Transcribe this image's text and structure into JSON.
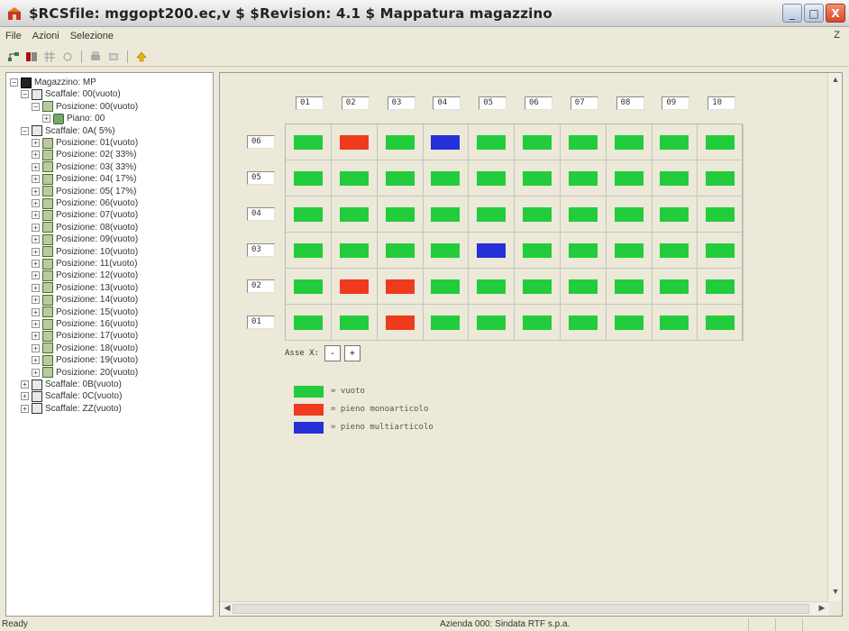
{
  "window": {
    "title": "$RCSfile: mggopt200.ec,v $ $Revision: 4.1 $ Mappatura magazzino",
    "min_glyph": "_",
    "max_glyph": "□",
    "close_glyph": "X"
  },
  "menu": {
    "items": [
      "File",
      "Azioni",
      "Selezione"
    ],
    "right_mark": "Z"
  },
  "tree": {
    "nodes": [
      {
        "level": 0,
        "exp": "−",
        "icon": "magazzino",
        "label": "Magazzino: MP"
      },
      {
        "level": 1,
        "exp": "−",
        "icon": "scaffale",
        "label": "Scaffale: 00(vuoto)"
      },
      {
        "level": 2,
        "exp": "−",
        "icon": "posizione",
        "label": "Posizione: 00(vuoto)"
      },
      {
        "level": 3,
        "exp": "+",
        "icon": "piano",
        "label": "Piano: 00"
      },
      {
        "level": 1,
        "exp": "−",
        "icon": "scaffale",
        "label": "Scaffale: 0A( 5%)"
      },
      {
        "level": 2,
        "exp": "+",
        "icon": "posizione",
        "label": "Posizione: 01(vuoto)"
      },
      {
        "level": 2,
        "exp": "+",
        "icon": "posizione",
        "label": "Posizione: 02( 33%)"
      },
      {
        "level": 2,
        "exp": "+",
        "icon": "posizione",
        "label": "Posizione: 03( 33%)"
      },
      {
        "level": 2,
        "exp": "+",
        "icon": "posizione",
        "label": "Posizione: 04( 17%)"
      },
      {
        "level": 2,
        "exp": "+",
        "icon": "posizione",
        "label": "Posizione: 05( 17%)"
      },
      {
        "level": 2,
        "exp": "+",
        "icon": "posizione",
        "label": "Posizione: 06(vuoto)"
      },
      {
        "level": 2,
        "exp": "+",
        "icon": "posizione",
        "label": "Posizione: 07(vuoto)"
      },
      {
        "level": 2,
        "exp": "+",
        "icon": "posizione",
        "label": "Posizione: 08(vuoto)"
      },
      {
        "level": 2,
        "exp": "+",
        "icon": "posizione",
        "label": "Posizione: 09(vuoto)"
      },
      {
        "level": 2,
        "exp": "+",
        "icon": "posizione",
        "label": "Posizione: 10(vuoto)"
      },
      {
        "level": 2,
        "exp": "+",
        "icon": "posizione",
        "label": "Posizione: 11(vuoto)"
      },
      {
        "level": 2,
        "exp": "+",
        "icon": "posizione",
        "label": "Posizione: 12(vuoto)"
      },
      {
        "level": 2,
        "exp": "+",
        "icon": "posizione",
        "label": "Posizione: 13(vuoto)"
      },
      {
        "level": 2,
        "exp": "+",
        "icon": "posizione",
        "label": "Posizione: 14(vuoto)"
      },
      {
        "level": 2,
        "exp": "+",
        "icon": "posizione",
        "label": "Posizione: 15(vuoto)"
      },
      {
        "level": 2,
        "exp": "+",
        "icon": "posizione",
        "label": "Posizione: 16(vuoto)"
      },
      {
        "level": 2,
        "exp": "+",
        "icon": "posizione",
        "label": "Posizione: 17(vuoto)"
      },
      {
        "level": 2,
        "exp": "+",
        "icon": "posizione",
        "label": "Posizione: 18(vuoto)"
      },
      {
        "level": 2,
        "exp": "+",
        "icon": "posizione",
        "label": "Posizione: 19(vuoto)"
      },
      {
        "level": 2,
        "exp": "+",
        "icon": "posizione",
        "label": "Posizione: 20(vuoto)"
      },
      {
        "level": 1,
        "exp": "+",
        "icon": "scaffale",
        "label": "Scaffale: 0B(vuoto)"
      },
      {
        "level": 1,
        "exp": "+",
        "icon": "scaffale",
        "label": "Scaffale: 0C(vuoto)"
      },
      {
        "level": 1,
        "exp": "+",
        "icon": "scaffale",
        "label": "Scaffale: ZZ(vuoto)"
      }
    ]
  },
  "grid": {
    "columns": [
      "01",
      "02",
      "03",
      "04",
      "05",
      "06",
      "07",
      "08",
      "09",
      "10"
    ],
    "rows": [
      {
        "label": "06",
        "cells": [
          "vuoto",
          "mono",
          "vuoto",
          "multi",
          "vuoto",
          "vuoto",
          "vuoto",
          "vuoto",
          "vuoto",
          "vuoto"
        ]
      },
      {
        "label": "05",
        "cells": [
          "vuoto",
          "vuoto",
          "vuoto",
          "vuoto",
          "vuoto",
          "vuoto",
          "vuoto",
          "vuoto",
          "vuoto",
          "vuoto"
        ]
      },
      {
        "label": "04",
        "cells": [
          "vuoto",
          "vuoto",
          "vuoto",
          "vuoto",
          "vuoto",
          "vuoto",
          "vuoto",
          "vuoto",
          "vuoto",
          "vuoto"
        ]
      },
      {
        "label": "03",
        "cells": [
          "vuoto",
          "vuoto",
          "vuoto",
          "vuoto",
          "multi",
          "vuoto",
          "vuoto",
          "vuoto",
          "vuoto",
          "vuoto"
        ]
      },
      {
        "label": "02",
        "cells": [
          "vuoto",
          "mono",
          "mono",
          "vuoto",
          "vuoto",
          "vuoto",
          "vuoto",
          "vuoto",
          "vuoto",
          "vuoto"
        ]
      },
      {
        "label": "01",
        "cells": [
          "vuoto",
          "vuoto",
          "mono",
          "vuoto",
          "vuoto",
          "vuoto",
          "vuoto",
          "vuoto",
          "vuoto",
          "vuoto"
        ]
      }
    ]
  },
  "axis": {
    "label": "Asse X:",
    "minus": "-",
    "plus": "+"
  },
  "legend": [
    {
      "key": "vuoto",
      "color": "#22cc3c",
      "text": "= vuoto"
    },
    {
      "key": "mono",
      "color": "#ee3a1e",
      "text": "= pieno monoarticolo"
    },
    {
      "key": "multi",
      "color": "#2530d8",
      "text": "= pieno multiarticolo"
    }
  ],
  "status": {
    "left": "Ready",
    "right": "Azienda 000: Sindata RTF s.p.a."
  }
}
